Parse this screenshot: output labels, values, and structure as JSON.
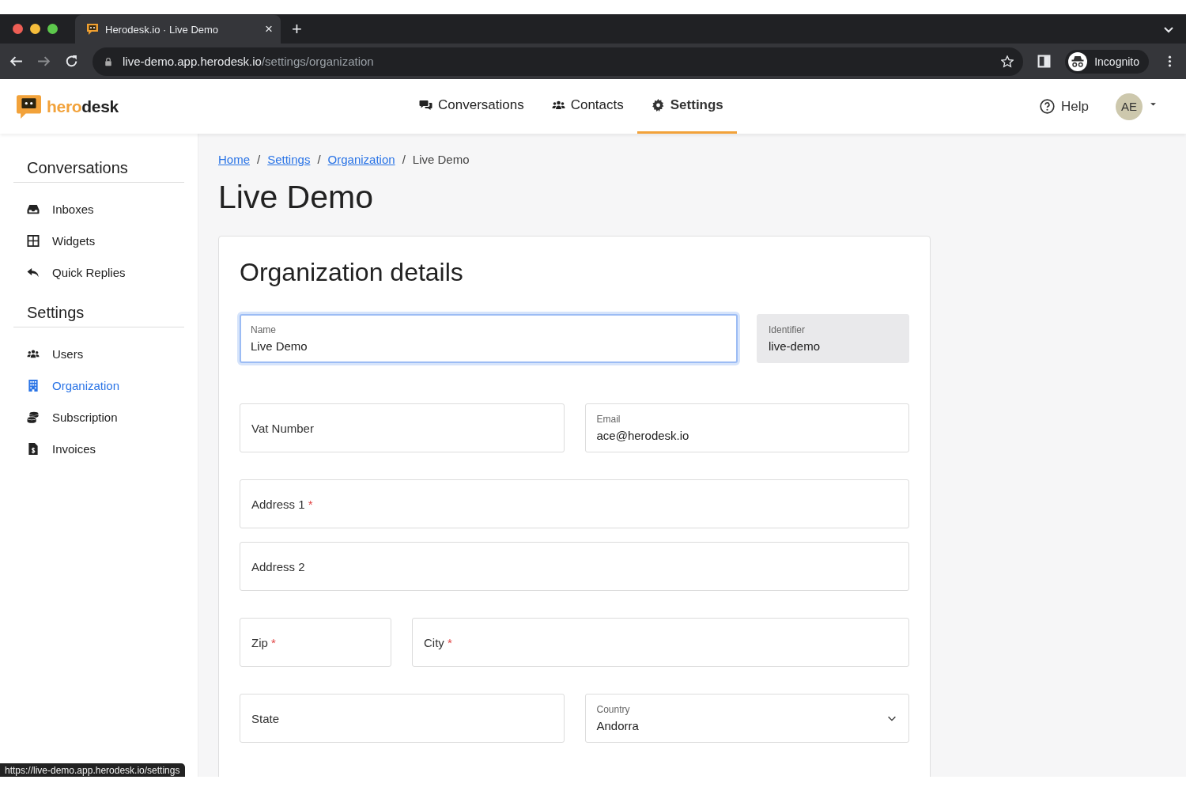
{
  "browser": {
    "tab": {
      "title": "Herodesk.io · Live Demo",
      "close": "×",
      "selected": true
    },
    "new_tab": "+",
    "url": {
      "host": "live-demo.app.herodesk.io",
      "path": "/settings/organization"
    },
    "profile": "Incognito",
    "status_url": "https://live-demo.app.herodesk.io/settings"
  },
  "header": {
    "logo": {
      "part_1": "hero",
      "part_2": "desk"
    },
    "nav": [
      {
        "label": "Conversations",
        "kind": "chat",
        "selected": false
      },
      {
        "label": "Contacts",
        "kind": "users",
        "selected": false
      },
      {
        "label": "Settings",
        "kind": "gear",
        "selected": true
      }
    ],
    "help": "Help",
    "avatar": "AE"
  },
  "sidebar": {
    "sections": [
      {
        "title": "Conversations",
        "items": [
          {
            "label": "Inboxes",
            "kind": "inbox",
            "selected": false
          },
          {
            "label": "Widgets",
            "kind": "grid",
            "selected": false
          },
          {
            "label": "Quick Replies",
            "kind": "reply",
            "selected": false
          }
        ]
      },
      {
        "title": "Settings",
        "items": [
          {
            "label": "Users",
            "kind": "users",
            "selected": false
          },
          {
            "label": "Organization",
            "kind": "building",
            "selected": true
          },
          {
            "label": "Subscription",
            "kind": "coins",
            "selected": false
          },
          {
            "label": "Invoices",
            "kind": "invoice",
            "selected": false
          }
        ]
      }
    ]
  },
  "breadcrumb": [
    {
      "label": "Home",
      "kind": "link"
    },
    {
      "label": "Settings",
      "kind": "link"
    },
    {
      "label": "Organization",
      "kind": "link"
    },
    {
      "label": "Live Demo",
      "kind": "current"
    }
  ],
  "breadcrumb_separator": "/",
  "page_title": "Live Demo",
  "card": {
    "title": "Organization details",
    "rows": [
      [
        {
          "label": "Name",
          "value": "Live Demo",
          "focused": true,
          "disabled": false,
          "kind": "text"
        },
        {
          "label": "Identifier",
          "value": "live-demo",
          "focused": false,
          "disabled": true,
          "kind": "text"
        }
      ],
      [
        {
          "label": "Vat Number",
          "focused": false,
          "disabled": false,
          "kind": "text"
        },
        {
          "label": "Email",
          "value": "ace@herodesk.io",
          "focused": false,
          "disabled": false,
          "kind": "text"
        }
      ],
      [
        {
          "label": "Address 1",
          "mark": "*",
          "focused": false,
          "disabled": false,
          "kind": "text"
        }
      ],
      [
        {
          "label": "Address 2",
          "focused": false,
          "disabled": false,
          "kind": "text"
        }
      ],
      [
        {
          "label": "Zip",
          "mark": "*",
          "focused": false,
          "disabled": false,
          "kind": "text"
        },
        {
          "label": "City",
          "mark": "*",
          "focused": false,
          "disabled": false,
          "kind": "text"
        }
      ],
      [
        {
          "label": "State",
          "focused": false,
          "disabled": false,
          "kind": "text"
        },
        {
          "label": "Country",
          "value": "Andorra",
          "focused": false,
          "disabled": false,
          "kind": "select"
        }
      ]
    ]
  }
}
